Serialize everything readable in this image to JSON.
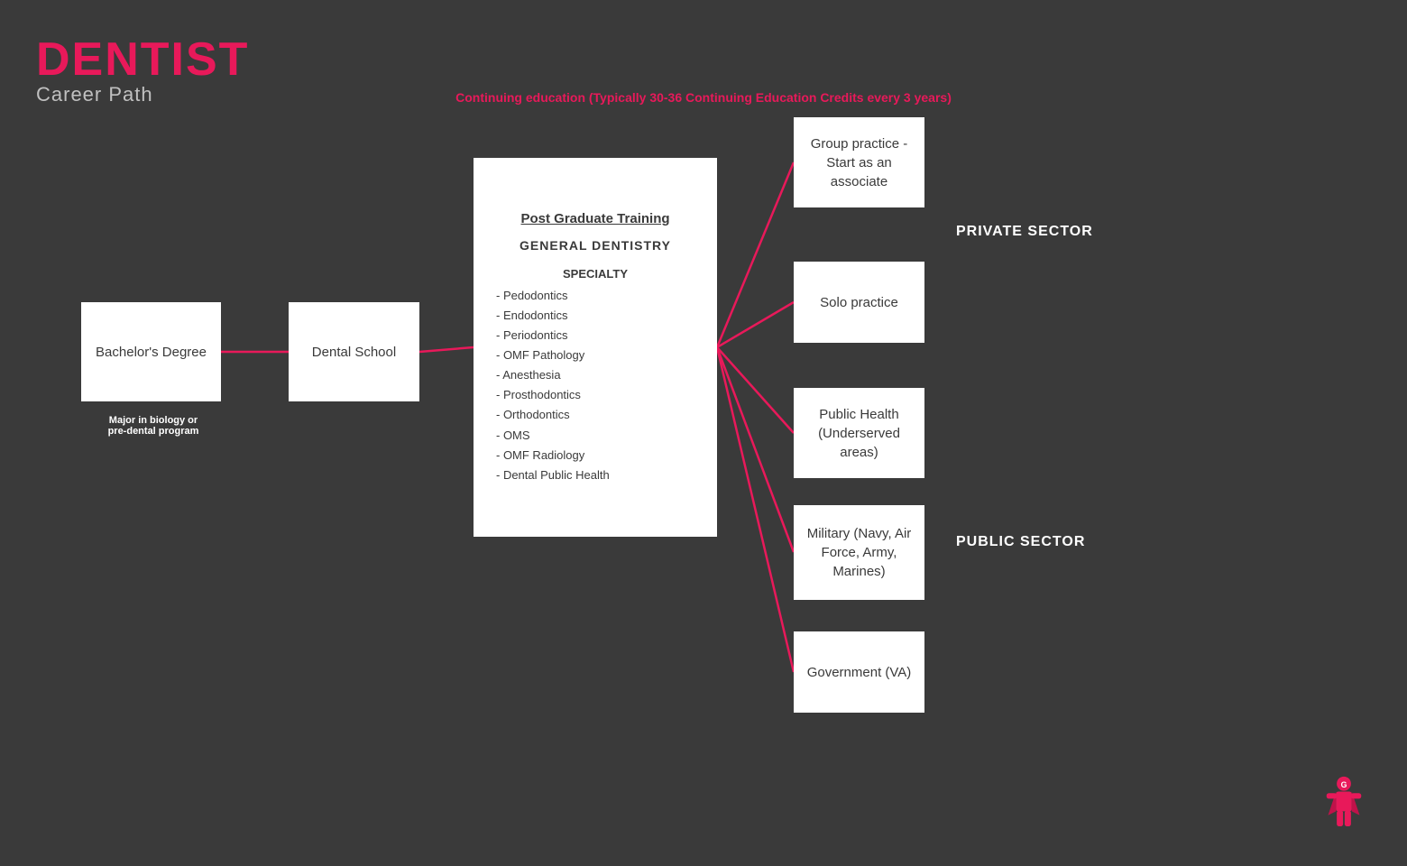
{
  "header": {
    "title": "DENTIST",
    "subtitle": "Career Path"
  },
  "cont_edu": {
    "text": "Continuing education (Typically 30-36 Continuing Education Credits every 3 years)"
  },
  "boxes": {
    "bachelors": {
      "label": "Bachelor's Degree",
      "sublabel": "Major in biology or\npre-dental program"
    },
    "dental_school": {
      "label": "Dental School"
    },
    "postgrad": {
      "title": "Post Graduate Training",
      "general": "GENERAL DENTISTRY",
      "specialty_header": "SPECIALTY",
      "items": [
        "- Pedodontics",
        "- Endodontics",
        "- Periodontics",
        "- OMF Pathology",
        "- Anesthesia",
        "- Prosthodontics",
        "- Orthodontics",
        "- OMS",
        "- OMF Radiology",
        "- Dental Public Health"
      ]
    },
    "group_practice": {
      "label": "Group practice -\nStart as an\nassociate"
    },
    "solo_practice": {
      "label": "Solo practice"
    },
    "public_health": {
      "label": "Public Health\n(Underserved\nareas)"
    },
    "military": {
      "label": "Military (Navy, Air\nForce, Army,\nMarines)"
    },
    "government": {
      "label": "Government (VA)"
    }
  },
  "sectors": {
    "private": "PRIVATE SECTOR",
    "public": "PUBLIC SECTOR"
  },
  "colors": {
    "pink": "#e8195a",
    "bg": "#3a3a3a",
    "white": "#ffffff",
    "box_text": "#3a3a3a"
  }
}
